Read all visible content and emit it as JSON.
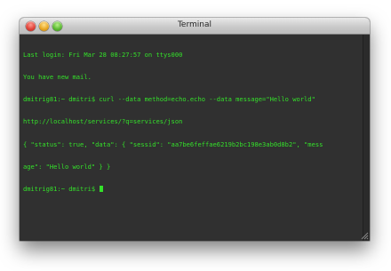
{
  "window": {
    "title": "Terminal"
  },
  "terminal": {
    "lines": [
      "Last login: Fri Mar 28 08:27:57 on ttys000",
      "You have new mail.",
      "dmitrig81:~ dmitri$ curl --data method=echo.echo --data message=\"Hello world\"",
      "http://localhost/services/?q=services/json",
      "{ \"status\": true, \"data\": { \"sessid\": \"aa7be6feffae6219b2bc198e3ab0d8b2\", \"mess",
      "age\": \"Hello world\" } }",
      "dmitrig81:~ dmitri$ "
    ],
    "text_color": "#34e02a",
    "background_color": "#303030"
  },
  "icons": {
    "close": "close-button-icon",
    "minimize": "minimize-button-icon",
    "zoom": "zoom-button-icon",
    "resize": "resize-grip-icon"
  }
}
